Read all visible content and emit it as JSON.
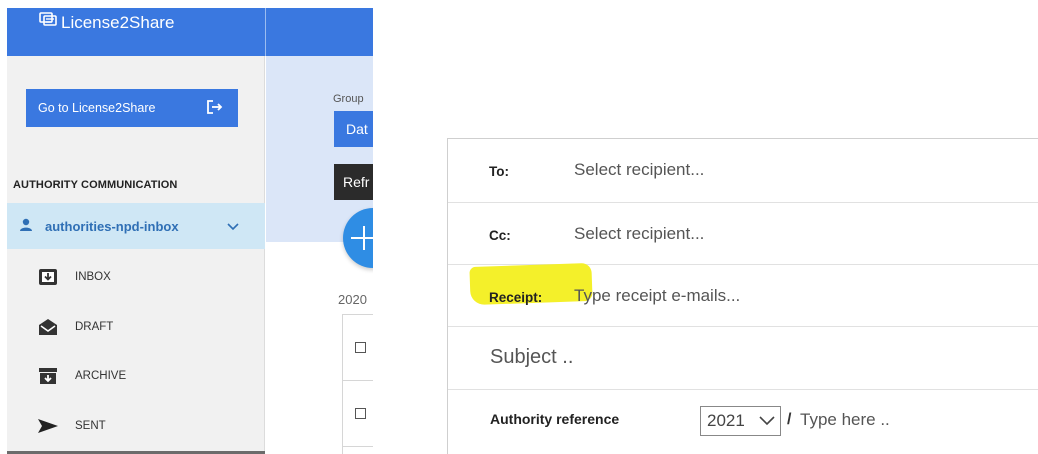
{
  "app": {
    "brand": "License2Share"
  },
  "sidebar": {
    "go_button_label": "Go to License2Share",
    "section_title": "AUTHORITY COMMUNICATION",
    "mailbox": "authorities-npd-inbox",
    "items": [
      {
        "label": "INBOX",
        "icon": "inbox-icon"
      },
      {
        "label": "DRAFT",
        "icon": "draft-icon"
      },
      {
        "label": "ARCHIVE",
        "icon": "archive-icon"
      },
      {
        "label": "SENT",
        "icon": "sent-icon"
      }
    ]
  },
  "main": {
    "group_label": "Group",
    "group_button": "Dat",
    "refresh_button": "Refr",
    "year": "2020"
  },
  "compose": {
    "to_label": "To:",
    "to_placeholder": "Select recipient...",
    "cc_label": "Cc:",
    "cc_placeholder": "Select recipient...",
    "receipt_label": "Receipt:",
    "receipt_placeholder": "Type receipt e-mails...",
    "subject_placeholder": "Subject ..",
    "authority_reference_label": "Authority reference",
    "ref_year": "2021",
    "ref_separator": "/",
    "ref_placeholder": "Type here .."
  },
  "colors": {
    "primary": "#3a78e0",
    "selected_row": "#cfe7f5",
    "sidebar_bg": "#f1f1f1",
    "highlight": "#f4f02a",
    "fab": "#2f8de4"
  }
}
